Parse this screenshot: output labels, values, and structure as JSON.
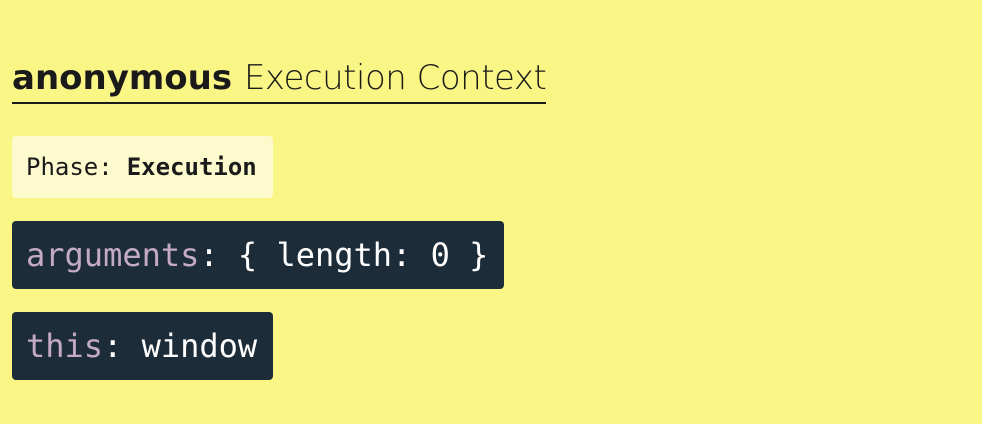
{
  "heading": {
    "function_name": "anonymous",
    "context_label": "Execution Context"
  },
  "phase": {
    "label": "Phase:",
    "value": "Execution"
  },
  "variables": [
    {
      "key": "arguments",
      "separator": ":",
      "value": "{ length: 0 }"
    },
    {
      "key": "this",
      "separator": ":",
      "value": "window"
    }
  ],
  "colors": {
    "background": "#f9f685",
    "phase_box": "#fdfbce",
    "code_box": "#1c2d39",
    "code_key": "#c4a9c8",
    "code_value": "#ffffff"
  }
}
